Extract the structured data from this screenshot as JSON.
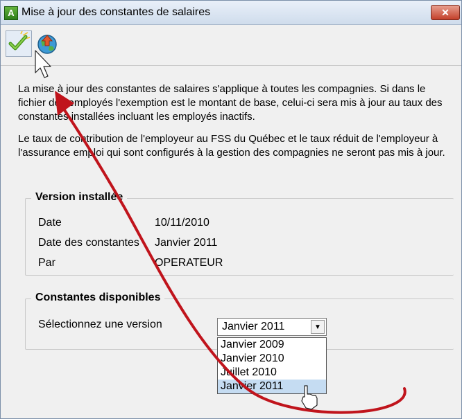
{
  "window": {
    "title": "Mise à jour des constantes de salaires",
    "close_glyph": "✕"
  },
  "app_icon_letter": "A",
  "toolbar": {
    "buttons": [
      {
        "name": "apply-checkmark-icon",
        "color": "#6cb52d"
      },
      {
        "name": "globe-update-icon",
        "color": "#d9532a"
      }
    ]
  },
  "description": {
    "paragraph1": "La mise à jour des constantes de salaires s'applique à toutes les compagnies. Si dans le fichier des employés l'exemption est le montant de base, celui-ci sera mis à jour au taux des constantes installées incluant les employés inactifs.",
    "paragraph2": "Le taux de contribution de l'employeur au  FSS du Québec et le taux réduit de l'employeur à l'assurance emploi qui sont configurés à la gestion des compagnies ne seront pas mis à jour."
  },
  "installed_version": {
    "title": "Version installée",
    "rows": [
      {
        "label": "Date",
        "value": "10/11/2010"
      },
      {
        "label": "Date des constantes",
        "value": "Janvier 2011"
      },
      {
        "label": "Par",
        "value": "OPERATEUR"
      }
    ]
  },
  "available_constants": {
    "title": "Constantes disponibles",
    "select_label": "Sélectionnez une version",
    "selected_value": "Janvier 2011",
    "options": [
      "Janvier 2009",
      "Janvier 2010",
      "Juillet 2010",
      "Janvier 2011"
    ],
    "highlighted_option": "Janvier 2011"
  },
  "colors": {
    "annotation_arrow": "#c0141c",
    "selection_highlight": "#c5dcf2"
  }
}
